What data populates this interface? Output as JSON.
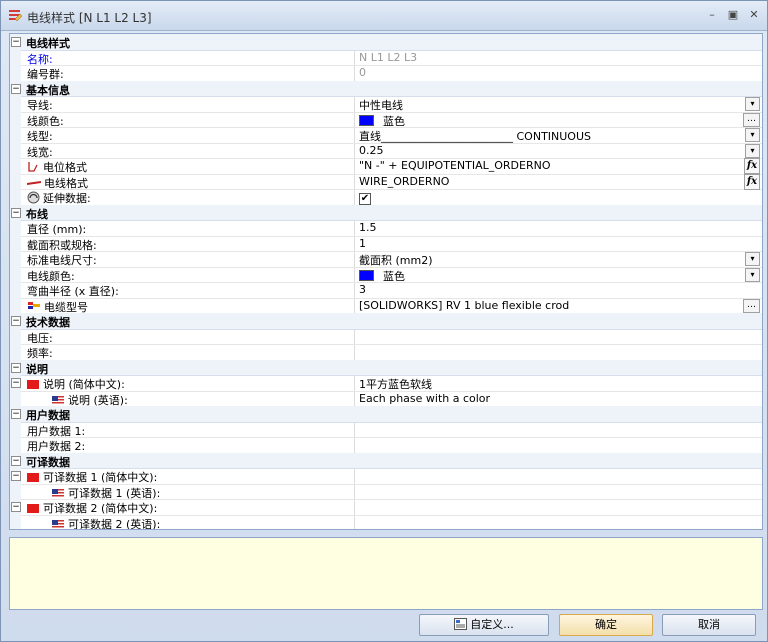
{
  "window": {
    "title": "电线样式 [N L1 L2 L3]",
    "minimize": "–",
    "maximize": "▣",
    "close": "✕"
  },
  "rows": [
    {
      "type": "cat",
      "label": "电线样式",
      "toggle": "−"
    },
    {
      "type": "prop",
      "label": "名称:",
      "value": "N L1 L2 L3",
      "label_style": "blue",
      "value_style": "gray"
    },
    {
      "type": "prop",
      "label": "编号群:",
      "value": "0",
      "value_style": "gray"
    },
    {
      "type": "cat",
      "label": "基本信息",
      "toggle": "−"
    },
    {
      "type": "prop",
      "label": "导线:",
      "value": "中性电线",
      "control": "dropdown"
    },
    {
      "type": "prop",
      "label": "线颜色:",
      "value": "蓝色",
      "swatch": "#0000ff",
      "control": "ellipsis"
    },
    {
      "type": "prop",
      "label": "线型:",
      "value": "直线________________________ CONTINUOUS",
      "control": "dropdown"
    },
    {
      "type": "prop",
      "label": "线宽:",
      "value": "0.25",
      "control": "dropdown"
    },
    {
      "type": "prop",
      "label": "电位格式",
      "value": "\"N -\" + EQUIPOTENTIAL_ORDERNO",
      "icon": "potential-icon",
      "control": "fx"
    },
    {
      "type": "prop",
      "label": "电线格式",
      "value": "WIRE_ORDERNO",
      "icon": "wire-icon",
      "control": "fx"
    },
    {
      "type": "prop",
      "label": "延伸数据:",
      "value": "✔",
      "icon": "extend-icon",
      "control": "checkbox"
    },
    {
      "type": "cat",
      "label": "布线",
      "toggle": "−"
    },
    {
      "type": "prop",
      "label": "直径 (mm):",
      "value": "1.5"
    },
    {
      "type": "prop",
      "label": "截面积或规格:",
      "value": "1"
    },
    {
      "type": "prop",
      "label": "标准电线尺寸:",
      "value": "截面积 (mm2)",
      "control": "dropdown"
    },
    {
      "type": "prop",
      "label": "电线颜色:",
      "value": "蓝色",
      "swatch": "#0000ff",
      "control": "dropdown"
    },
    {
      "type": "prop",
      "label": "弯曲半径 (x 直径):",
      "value": "3"
    },
    {
      "type": "prop",
      "label": "电缆型号",
      "value": "[SOLIDWORKS] RV 1 blue flexible crod",
      "icon": "cable-icon",
      "control": "ellipsis"
    },
    {
      "type": "cat",
      "label": "技术数据",
      "toggle": "−"
    },
    {
      "type": "prop",
      "label": "电压:",
      "value": ""
    },
    {
      "type": "prop",
      "label": "频率:",
      "value": ""
    },
    {
      "type": "cat",
      "label": "说明",
      "toggle": "−"
    },
    {
      "type": "prop",
      "label": "说明 (简体中文):",
      "value": "1平方蓝色软线",
      "flag": "cn",
      "toggle": "−"
    },
    {
      "type": "prop",
      "label": "说明 (英语):",
      "value": "Each phase with a color",
      "flag": "us",
      "indent": 2
    },
    {
      "type": "cat",
      "label": "用户数据",
      "toggle": "−"
    },
    {
      "type": "prop",
      "label": "用户数据 1:",
      "value": ""
    },
    {
      "type": "prop",
      "label": "用户数据 2:",
      "value": ""
    },
    {
      "type": "cat",
      "label": "可译数据",
      "toggle": "−"
    },
    {
      "type": "prop",
      "label": "可译数据 1 (简体中文):",
      "value": "",
      "flag": "cn",
      "toggle": "−"
    },
    {
      "type": "prop",
      "label": "可译数据 1 (英语):",
      "value": "",
      "flag": "us",
      "indent": 2
    },
    {
      "type": "prop",
      "label": "可译数据 2 (简体中文):",
      "value": "",
      "flag": "cn",
      "toggle": "−"
    },
    {
      "type": "prop",
      "label": "可译数据 2 (英语):",
      "value": "",
      "flag": "us",
      "indent": 2
    }
  ],
  "buttons": {
    "customize": "自定义...",
    "ok": "确定",
    "cancel": "取消"
  }
}
